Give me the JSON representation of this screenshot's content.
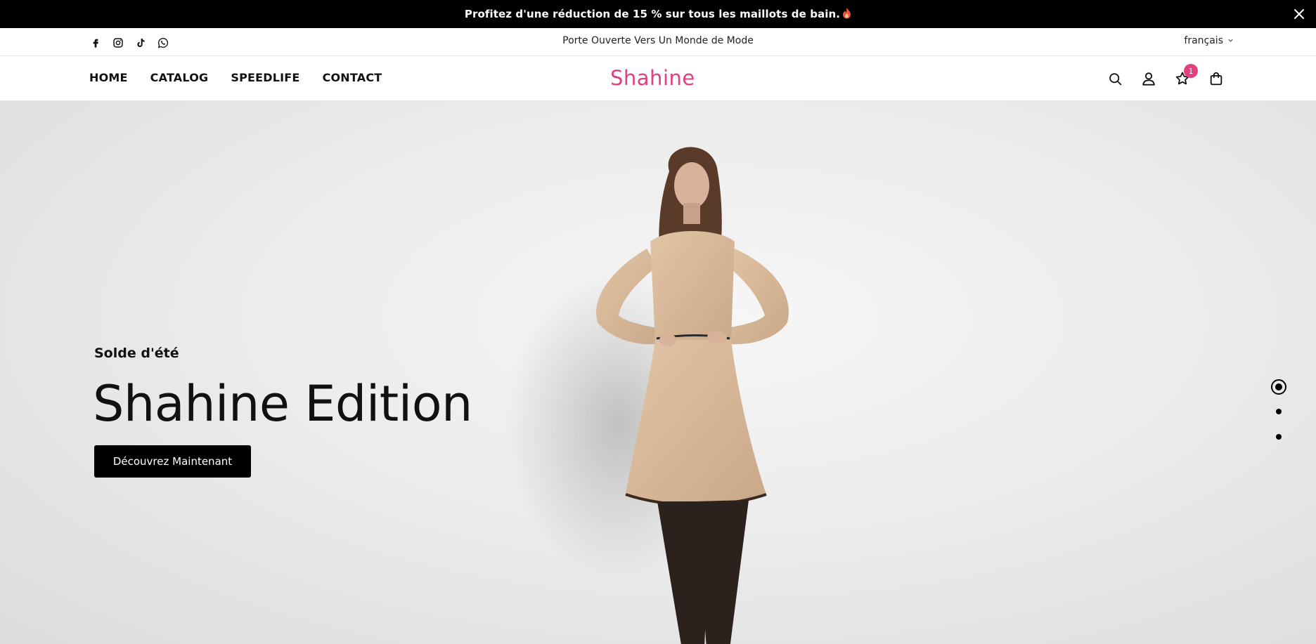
{
  "announcement": {
    "text": "Profitez d'une réduction de 15 % sur tous les maillots de bain."
  },
  "topbar": {
    "socials": [
      "facebook-icon",
      "instagram-icon",
      "tiktok-icon",
      "whatsapp-icon"
    ],
    "tagline": "Porte Ouverte Vers Un Monde de Mode",
    "language": "français"
  },
  "header": {
    "nav": [
      "HOME",
      "CATALOG",
      "SPEEDLIFE",
      "CONTACT"
    ],
    "logo": "Shahine",
    "wishlist_count": "1",
    "accent_color": "#e0407e"
  },
  "hero": {
    "subtitle": "Solde d'été",
    "title": "Shahine Edition",
    "cta": "Découvrez Maintenant",
    "slides": 3,
    "active_slide": 1
  }
}
